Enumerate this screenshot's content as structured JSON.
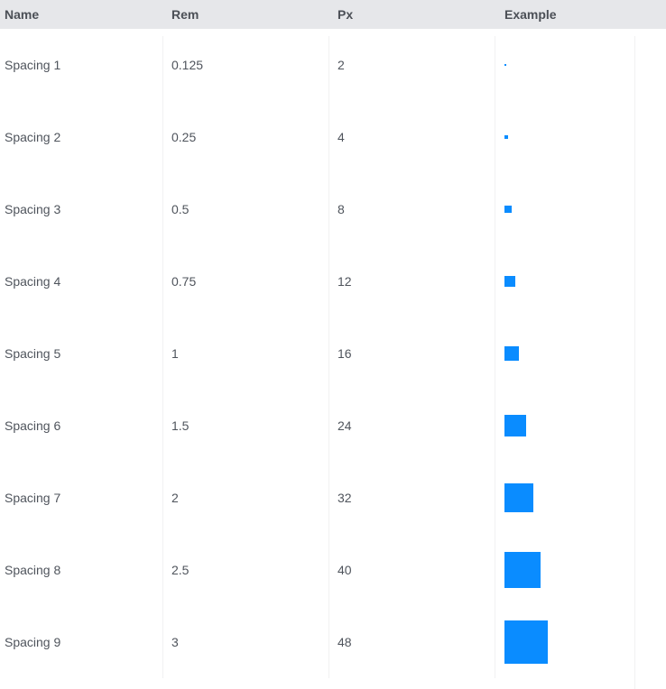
{
  "columns": [
    "Name",
    "Rem",
    "Px",
    "Example"
  ],
  "swatch_color": "#0a8cff",
  "rows": [
    {
      "name": "Spacing 1",
      "rem": "0.125",
      "px": "2"
    },
    {
      "name": "Spacing 2",
      "rem": "0.25",
      "px": "4"
    },
    {
      "name": "Spacing 3",
      "rem": "0.5",
      "px": "8"
    },
    {
      "name": "Spacing 4",
      "rem": "0.75",
      "px": "12"
    },
    {
      "name": "Spacing 5",
      "rem": "1",
      "px": "16"
    },
    {
      "name": "Spacing 6",
      "rem": "1.5",
      "px": "24"
    },
    {
      "name": "Spacing 7",
      "rem": "2",
      "px": "32"
    },
    {
      "name": "Spacing 8",
      "rem": "2.5",
      "px": "40"
    },
    {
      "name": "Spacing 9",
      "rem": "3",
      "px": "48"
    }
  ]
}
